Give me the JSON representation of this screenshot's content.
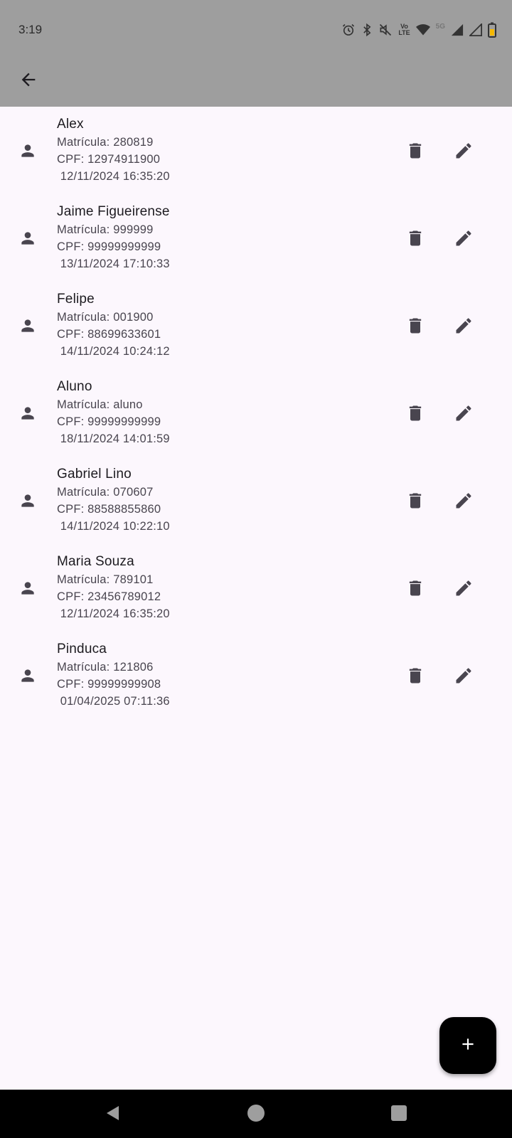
{
  "status_bar": {
    "time": "3:19",
    "icons": [
      "alarm-icon",
      "bluetooth-icon",
      "mute-icon",
      "volte-icon",
      "wifi-icon",
      "5g-icon",
      "signal-icon",
      "signal-icon-2",
      "battery-icon"
    ],
    "volte_label_top": "Vo",
    "volte_label_bottom": "LTE",
    "net_label": "5G"
  },
  "app_bar": {
    "back_icon": "arrow-back-icon"
  },
  "students": [
    {
      "name": "Alex",
      "matricula": "Matrícula: 280819",
      "cpf": "CPF: 12974911900",
      "datetime": " 12/11/2024 16:35:20"
    },
    {
      "name": "Jaime Figueirense",
      "matricula": "Matrícula: 999999",
      "cpf": "CPF: 99999999999",
      "datetime": " 13/11/2024 17:10:33"
    },
    {
      "name": "Felipe",
      "matricula": "Matrícula: 001900",
      "cpf": "CPF: 88699633601",
      "datetime": " 14/11/2024 10:24:12"
    },
    {
      "name": "Aluno",
      "matricula": "Matrícula: aluno",
      "cpf": "CPF: 99999999999",
      "datetime": " 18/11/2024 14:01:59"
    },
    {
      "name": "Gabriel Lino",
      "matricula": "Matrícula: 070607",
      "cpf": "CPF: 88588855860",
      "datetime": " 14/11/2024 10:22:10"
    },
    {
      "name": "Maria Souza",
      "matricula": "Matrícula: 789101",
      "cpf": "CPF: 23456789012",
      "datetime": " 12/11/2024 16:35:20"
    },
    {
      "name": "Pinduca",
      "matricula": "Matrícula: 121806",
      "cpf": "CPF: 99999999908",
      "datetime": " 01/04/2025 07:11:36"
    }
  ],
  "row_icons": {
    "leading": "person-icon",
    "delete": "trash-icon",
    "edit": "pencil-icon"
  },
  "fab": {
    "icon": "plus-icon"
  },
  "nav_bar": {
    "back": "nav-back-icon",
    "home": "nav-home-icon",
    "recents": "nav-recents-icon"
  },
  "colors": {
    "app_bar": "#9e9e9e",
    "background": "#fcf7fd",
    "icon": "#49454f",
    "fab": "#000000",
    "battery_accent": "#f5b800"
  }
}
